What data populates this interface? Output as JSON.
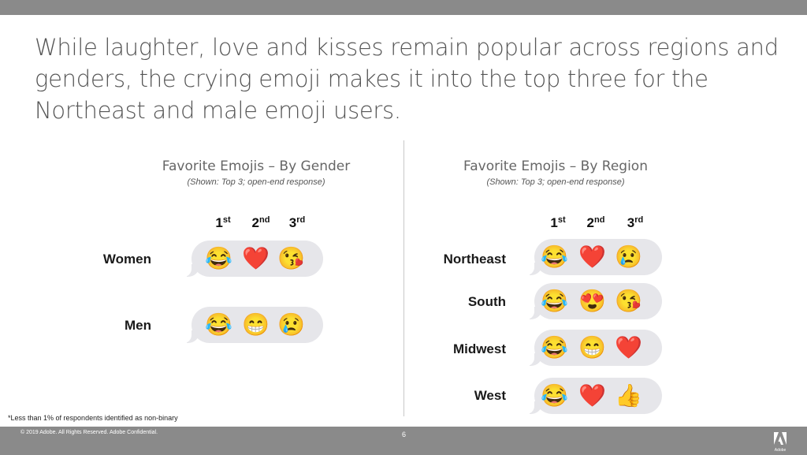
{
  "headline": "While laughter, love and kisses remain popular across regions and genders, the crying emoji makes it into the top three for the Northeast and male emoji users.",
  "ranks": [
    {
      "num": "1",
      "suffix": "st"
    },
    {
      "num": "2",
      "suffix": "nd"
    },
    {
      "num": "3",
      "suffix": "rd"
    }
  ],
  "gender_panel": {
    "title": "Favorite Emojis – By Gender",
    "subtitle": "(Shown: Top 3; open-end response)",
    "rows": [
      {
        "label": "Women",
        "emojis": [
          "😂",
          "❤️",
          "😘"
        ],
        "emoji_names": [
          "tears-of-joy",
          "red-heart",
          "face-blowing-kiss"
        ]
      },
      {
        "label": "Men",
        "emojis": [
          "😂",
          "😁",
          "😢"
        ],
        "emoji_names": [
          "tears-of-joy",
          "beaming-face",
          "crying-face"
        ]
      }
    ]
  },
  "region_panel": {
    "title": "Favorite Emojis – By Region",
    "subtitle": "(Shown: Top 3; open-end response)",
    "rows": [
      {
        "label": "Northeast",
        "emojis": [
          "😂",
          "❤️",
          "😢"
        ],
        "emoji_names": [
          "tears-of-joy",
          "red-heart",
          "crying-face"
        ]
      },
      {
        "label": "South",
        "emojis": [
          "😂",
          "😍",
          "😘"
        ],
        "emoji_names": [
          "tears-of-joy",
          "heart-eyes",
          "face-blowing-kiss"
        ]
      },
      {
        "label": "Midwest",
        "emojis": [
          "😂",
          "😁",
          "❤️"
        ],
        "emoji_names": [
          "tears-of-joy",
          "beaming-face",
          "red-heart"
        ]
      },
      {
        "label": "West",
        "emojis": [
          "😂",
          "❤️",
          "👍"
        ],
        "emoji_names": [
          "tears-of-joy",
          "red-heart",
          "thumbs-up"
        ]
      }
    ]
  },
  "footnote": "*Less than 1% of respondents identified as non-binary",
  "footer": {
    "copyright": "© 2019 Adobe.  All Rights Reserved. Adobe Confidential.",
    "page_number": "6",
    "logo_text": "Adobe"
  }
}
